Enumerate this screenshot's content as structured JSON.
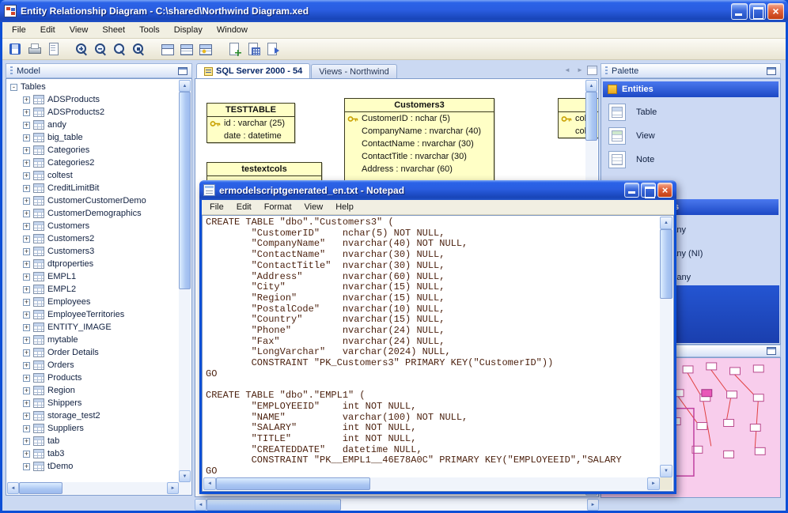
{
  "app": {
    "title": "Entity Relationship Diagram - C:\\shared\\Northwind Diagram.xed",
    "menu": [
      "File",
      "Edit",
      "View",
      "Sheet",
      "Tools",
      "Display",
      "Window"
    ],
    "toolbar_icons": [
      "save",
      "print",
      "print-preview",
      "zoom-in",
      "zoom-out",
      "zoom-actual",
      "zoom-fit",
      "entity-level",
      "attribute-level",
      "key-level",
      "add-sheet",
      "sheet-grid",
      "sheet-export"
    ]
  },
  "model_panel": {
    "title": "Model",
    "root_label": "Tables",
    "tables": [
      "ADSProducts",
      "ADSProducts2",
      "andy",
      "big_table",
      "Categories",
      "Categories2",
      "coltest",
      "CreditLimitBit",
      "CustomerCustomerDemo",
      "CustomerDemographics",
      "Customers",
      "Customers2",
      "Customers3",
      "dtproperties",
      "EMPL1",
      "EMPL2",
      "Employees",
      "EmployeeTerritories",
      "ENTITY_IMAGE",
      "mytable",
      "Order Details",
      "Orders",
      "Products",
      "Region",
      "Shippers",
      "storage_test2",
      "Suppliers",
      "tab",
      "tab3",
      "tDemo"
    ]
  },
  "sheet_tabs": [
    {
      "label": "SQL Server 2000 - 54",
      "active": true
    },
    {
      "label": "Views - Northwind",
      "active": false
    }
  ],
  "diagram": {
    "testtable": {
      "name": "TESTTABLE",
      "fields": [
        {
          "text": "id : varchar (25)",
          "key": true
        },
        {
          "text": "date : datetime",
          "key": false
        }
      ]
    },
    "testextcols": {
      "name": "testextcols"
    },
    "customers3": {
      "name": "Customers3",
      "fields": [
        {
          "text": "CustomerID : nchar (5)",
          "key": true
        },
        {
          "text": "CompanyName : nvarchar (40)",
          "key": false
        },
        {
          "text": "ContactName : nvarchar (30)",
          "key": false
        },
        {
          "text": "ContactTitle : nvarchar (30)",
          "key": false
        },
        {
          "text": "Address : nvarchar (60)",
          "key": false
        }
      ]
    },
    "partial_entity": {
      "name": "",
      "fields": [
        {
          "text": "col",
          "key": true
        },
        {
          "text": "col",
          "key": false
        }
      ]
    }
  },
  "palette": {
    "title": "Palette",
    "entities_header": "Entities",
    "entity_items": [
      "Table",
      "View",
      "Note"
    ],
    "relationships_header": "Relationships",
    "relationship_items": [
      "One to Many",
      "One to Many (NI)",
      "Many to Many"
    ]
  },
  "notepad": {
    "title": "ermodelscriptgenerated_en.txt - Notepad",
    "menu": [
      "File",
      "Edit",
      "Format",
      "View",
      "Help"
    ],
    "lines": [
      "CREATE TABLE \"dbo\".\"Customers3\" (",
      "        \"CustomerID\"    nchar(5) NOT NULL,",
      "        \"CompanyName\"   nvarchar(40) NOT NULL,",
      "        \"ContactName\"   nvarchar(30) NULL,",
      "        \"ContactTitle\"  nvarchar(30) NULL,",
      "        \"Address\"       nvarchar(60) NULL,",
      "        \"City\"          nvarchar(15) NULL,",
      "        \"Region\"        nvarchar(15) NULL,",
      "        \"PostalCode\"    nvarchar(10) NULL,",
      "        \"Country\"       nvarchar(15) NULL,",
      "        \"Phone\"         nvarchar(24) NULL,",
      "        \"Fax\"           nvarchar(24) NULL,",
      "        \"LongVarchar\"   varchar(2024) NULL,",
      "        CONSTRAINT \"PK_Customers3\" PRIMARY KEY(\"CustomerID\"))",
      "GO",
      "",
      "CREATE TABLE \"dbo\".\"EMPL1\" (",
      "        \"EMPLOYEEID\"    int NOT NULL,",
      "        \"NAME\"          varchar(100) NOT NULL,",
      "        \"SALARY\"        int NOT NULL,",
      "        \"TITLE\"         int NOT NULL,",
      "        \"CREATEDDATE\"   datetime NULL,",
      "        CONSTRAINT \"PK__EMPL1__46E78A0C\" PRIMARY KEY(\"EMPLOYEEID\",\"SALARY",
      "GO"
    ]
  },
  "colors": {
    "titlebar_blue": "#2a5de0",
    "entity_fill": "#ffffc6",
    "palette_section_blue": "#2b55d8",
    "minimap_pink": "#f8cdec",
    "notepad_text": "#4a1f0c"
  }
}
